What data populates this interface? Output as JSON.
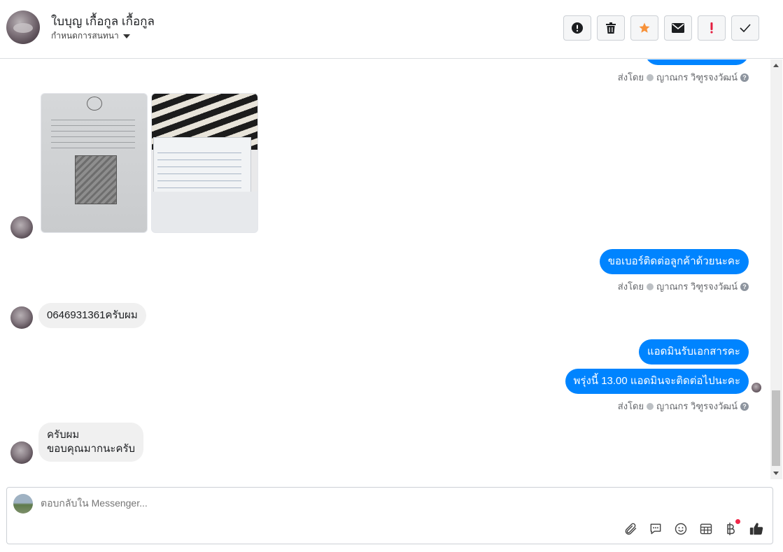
{
  "header": {
    "contact_name": "ใบบุญ เกื้อกูล เกื้อกูล",
    "assign_label": "กำหนดการสนทนา",
    "toolbar": [
      {
        "name": "spam-button",
        "icon": "alert-circle-icon"
      },
      {
        "name": "delete-button",
        "icon": "trash-icon"
      },
      {
        "name": "star-button",
        "icon": "star-icon"
      },
      {
        "name": "mark-unread-button",
        "icon": "envelope-icon"
      },
      {
        "name": "follow-up-button",
        "icon": "exclamation-icon"
      },
      {
        "name": "mark-done-button",
        "icon": "checkmark-icon"
      }
    ]
  },
  "colors": {
    "outgoing_bubble": "#0084ff",
    "incoming_bubble": "#f0f0f0",
    "star": "#f7923a",
    "follow_up": "#e41e3f"
  },
  "messages": {
    "sent_by_1": "ส่งโดย",
    "sender_name_1": "ญาณกร วิฑูรจงวัฒน์",
    "out_1": "ขอเบอร์ติดต่อลูกค้าด้วยนะคะ",
    "sent_by_2": "ส่งโดย",
    "sender_name_2": "ญาณกร วิฑูรจงวัฒน์",
    "in_1": "0646931361ครับผม",
    "out_2": "แอดมินรับเอกสารคะ",
    "out_3": "พรุ่งนี้ 13.00 แอดมินจะติดต่อไปนะคะ",
    "sent_by_3": "ส่งโดย",
    "sender_name_3": "ญาณกร วิฑูรจงวัฒน์",
    "in_2_line1": "ครับผม",
    "in_2_line2": "ขอบคุณมากนะครับ"
  },
  "composer": {
    "placeholder": "ตอบกลับใน Messenger...",
    "icons": [
      "paperclip-icon",
      "saved-reply-icon",
      "emoji-icon",
      "table-icon",
      "baht-icon",
      "thumbs-up-icon"
    ]
  }
}
